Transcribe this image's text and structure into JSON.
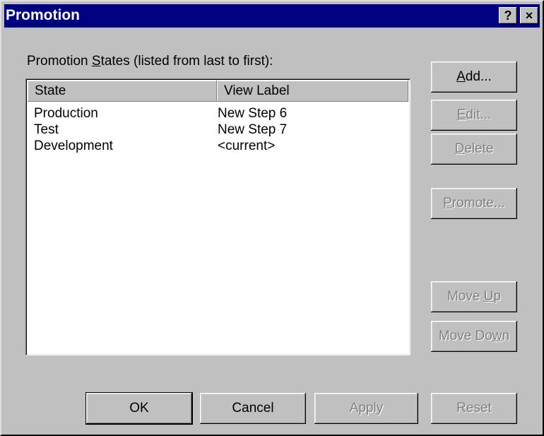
{
  "window": {
    "title": "Promotion",
    "help_icon": "?",
    "close_icon": "×"
  },
  "label": {
    "prefix": "Promotion ",
    "mnemonic": "S",
    "suffix": "tates (listed from last to first):"
  },
  "list": {
    "headers": [
      "State",
      "View Label"
    ],
    "rows": [
      {
        "state": "Production",
        "label": "New Step 6"
      },
      {
        "state": "Test",
        "label": "New Step 7"
      },
      {
        "state": "Development",
        "label": "<current>"
      }
    ]
  },
  "side_buttons": {
    "add": {
      "m": "A",
      "rest": "dd..."
    },
    "edit": {
      "m": "E",
      "rest": "dit..."
    },
    "delete": {
      "m": "D",
      "rest": "elete"
    },
    "promote": {
      "m": "P",
      "rest": "romote..."
    },
    "move_up": {
      "pre": "Move ",
      "m": "U",
      "rest": "p"
    },
    "move_down": {
      "pre": "Move Do",
      "m": "w",
      "rest": "n"
    }
  },
  "bottom_buttons": {
    "ok": "OK",
    "cancel": "Cancel",
    "apply": "Apply",
    "reset": "Reset"
  }
}
